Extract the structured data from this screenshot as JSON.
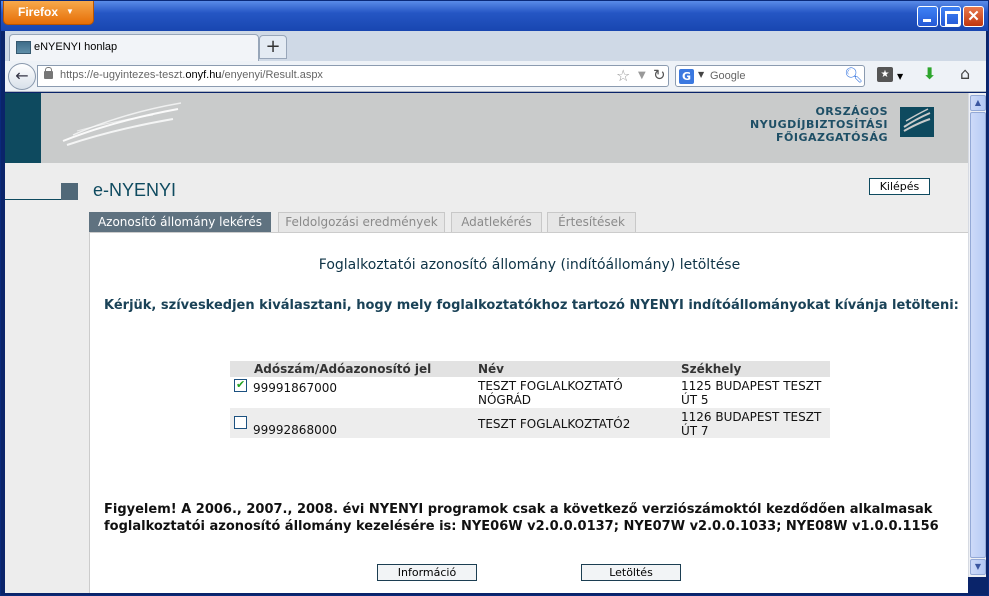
{
  "browser": {
    "menu_button": "Firefox",
    "tab_title": "eNYENYI honlap",
    "new_tab": "+",
    "url_prefix": "https://e-ugyintezes-teszt.",
    "url_domain": "onyf.hu",
    "url_path": "/enyenyi/Result.aspx",
    "search_engine": "G",
    "search_placeholder": "Google"
  },
  "header": {
    "org_line1": "ORSZÁGOS",
    "org_line2": "NYUGDÍJBIZTOSÍTÁSI",
    "org_line3": "FŐIGAZGATÓSÁG",
    "app_title": "e-NYENYI",
    "logout": "Kilépés"
  },
  "tabs": [
    {
      "label": "Azonosító állomány lekérés",
      "active": true
    },
    {
      "label": "Feldolgozási eredmények",
      "active": false
    },
    {
      "label": "Adatlekérés",
      "active": false
    },
    {
      "label": "Értesítések",
      "active": false
    }
  ],
  "main": {
    "heading": "Foglalkoztatói azonosító állomány (indítóállomány) letöltése",
    "intro": "Kérjük, szíveskedjen kiválasztani, hogy mely foglalkoztatókhoz tartozó NYENYI indítóállományokat kívánja letölteni:",
    "table": {
      "headers": [
        "Adószám/Adóazonosító jel",
        "Név",
        "Székhely"
      ],
      "rows": [
        {
          "checked": true,
          "tax_id": "99991867000",
          "name_1": "TESZT FOGLALKOZTATÓ",
          "name_2": "NÓGRÁD",
          "seat_1": "1125 BUDAPEST TESZT",
          "seat_2": "ÚT 5"
        },
        {
          "checked": false,
          "tax_id": "99992868000",
          "name_1": "TESZT FOGLALKOZTATÓ2",
          "name_2": "",
          "seat_1": "1126 BUDAPEST TESZT",
          "seat_2": "ÚT 7"
        }
      ]
    },
    "warning_line1": "Figyelem! A 2006., 2007., 2008. évi NYENYI programok csak a következő verziószámoktól kezdődően alkalmasak",
    "warning_line2": "foglalkoztatói azonosító állomány kezelésére is: NYE06W v2.0.0.0137; NYE07W v2.0.0.1033; NYE08W v1.0.0.1156",
    "info_button": "Információ",
    "download_button": "Letöltés"
  },
  "colors": {
    "brand_dark": "#0e4a5f",
    "active_tab": "#5f7280",
    "banner": "#c9cbcb"
  }
}
